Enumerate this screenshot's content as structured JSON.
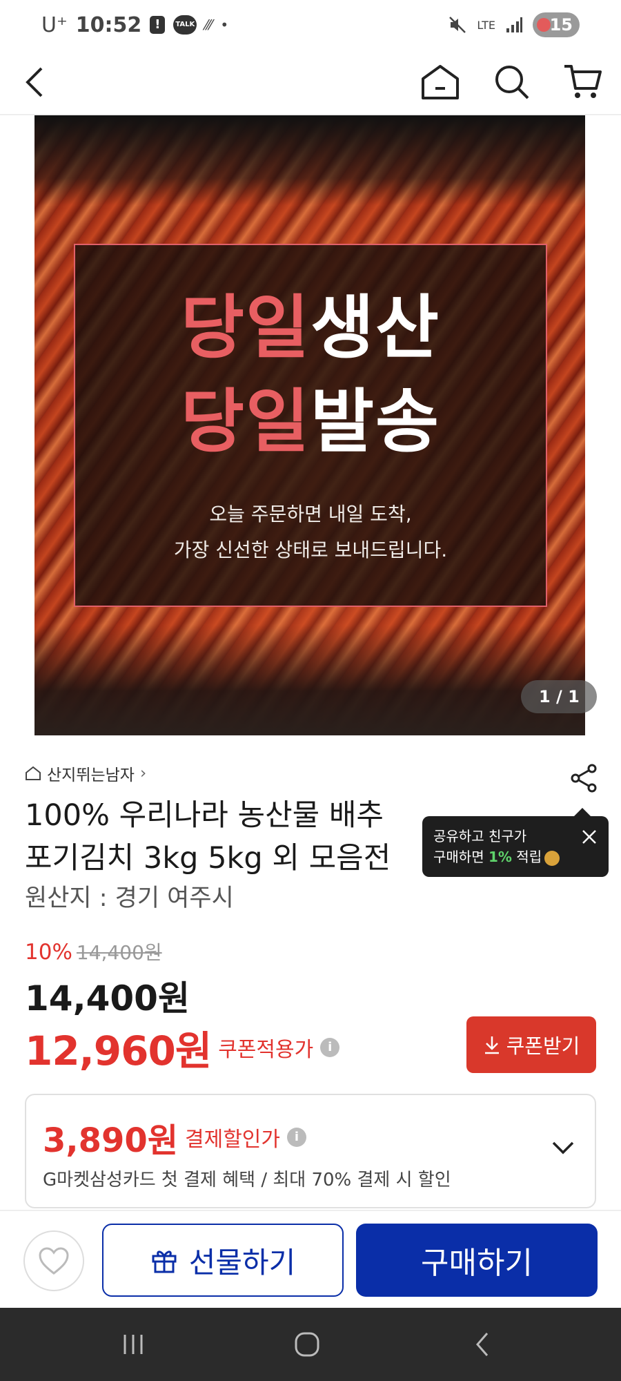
{
  "status_bar": {
    "carrier": "U⁺",
    "time": "10:52",
    "talk_badge": "TALK",
    "battery": "15",
    "network": "LTE"
  },
  "header": {
    "icons": [
      "back-icon",
      "home-icon",
      "search-icon",
      "cart-icon"
    ]
  },
  "hero": {
    "line1_red": "당일",
    "line1_white": "생산",
    "line2_red": "당일",
    "line2_white": "발송",
    "sub1": "오늘 주문하면 내일 도착,",
    "sub2": "가장 신선한 상태로 보내드립니다.",
    "counter": "1 / 1"
  },
  "product": {
    "seller": "산지뛰는남자",
    "title_line1": "100% 우리나라 농산물 배추",
    "title_line2": "포기김치 3kg 5kg 외 모음전",
    "origin": "원산지 : 경기 여주시",
    "discount_rate": "10%",
    "original_price": "14,400원",
    "price": "14,400원",
    "coupon_price": "12,960원",
    "coupon_label": "쿠폰적용가",
    "coupon_button": "쿠폰받기"
  },
  "tooltip": {
    "line1": "공유하고 친구가",
    "line2_prefix": "구매하면 ",
    "line2_highlight": "1%",
    "line2_suffix": " 적립"
  },
  "payment": {
    "amount": "3,890원",
    "label": "결제할인가",
    "description": "G마켓삼성카드 첫 결제 혜택 / 최대 70% 결제 시 할인"
  },
  "actions": {
    "gift": "선물하기",
    "buy": "구매하기"
  },
  "colors": {
    "accent_red": "#e2332e",
    "brand_blue": "#0a2ea8",
    "hero_red_text": "#e85f62"
  }
}
